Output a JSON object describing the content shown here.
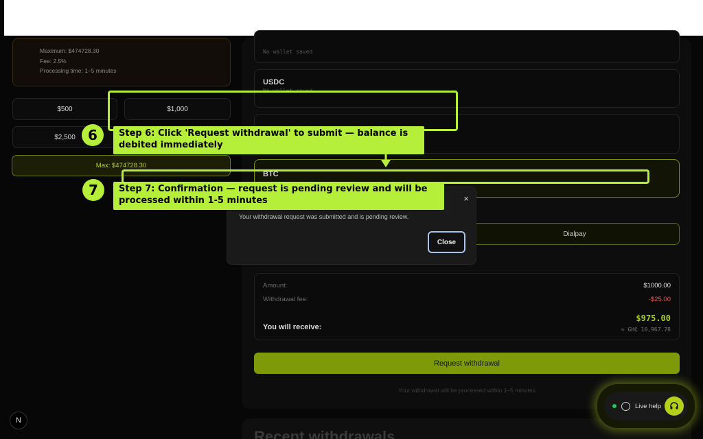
{
  "limits": {
    "maximum": "Maximum: $474728.30",
    "fee": "Fee: 2.5%",
    "processing": "Processing time: 1–5 minutes"
  },
  "quick_amounts": [
    "$500",
    "$1,000",
    "$2,500"
  ],
  "max_button": "Max: $474728.30",
  "wallets": {
    "first_status": "No wallet saved",
    "usdc": {
      "name": "USDC",
      "status": "No wallet saved"
    },
    "btc": {
      "name": "BTC"
    }
  },
  "method_option": "Dialpay",
  "summary": {
    "amount_label": "Amount:",
    "amount_value": "$1000.00",
    "fee_label": "Withdrawal fee:",
    "fee_value": "-$25.00",
    "receive_label": "You will receive:",
    "receive_value": "$975.00",
    "receive_local": "≈ GH₵ 10,967.78"
  },
  "request_button": "Request withdrawal",
  "footnote": "Your withdrawal will be processed within 1–5 minutes",
  "recent_title": "Recent withdrawals",
  "modal": {
    "message": "Your withdrawal request was submitted and is pending review.",
    "close_label": "Close",
    "close_icon": "×"
  },
  "logo_letter": "N",
  "live_help": "Live help",
  "steps": [
    {
      "number": "6",
      "text": "Step 6: Click 'Request withdrawal' to submit — balance is debited immediately"
    },
    {
      "number": "7",
      "text": "Step 7: Confirmation — request is pending review and will be processed within 1-5 minutes"
    }
  ],
  "colors": {
    "accent": "#b6ef3a",
    "primary_button": "#7f9a08",
    "fee_negative": "#e05555",
    "receive_positive": "#a8d01c"
  }
}
